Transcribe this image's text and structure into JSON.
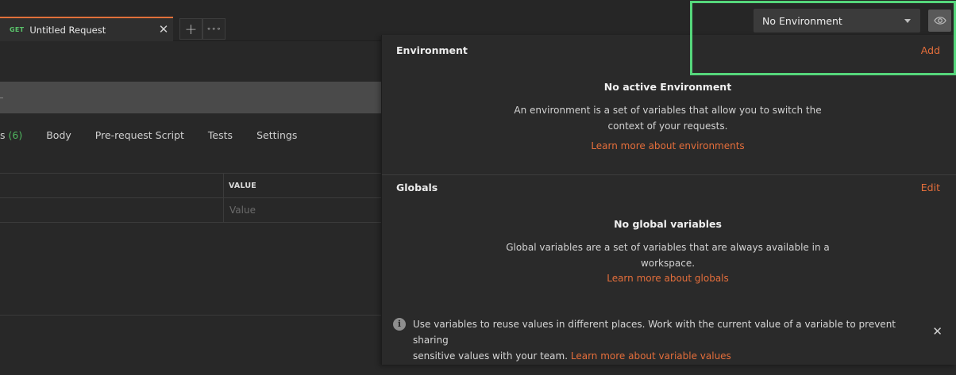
{
  "request_tab": {
    "method": "GET",
    "title": "Untitled Request",
    "close_glyph": "✕"
  },
  "tab_actions": {
    "new_tab_glyph": "+",
    "more_glyph": "∘∘∘"
  },
  "environment_selector": {
    "selected": "No Environment",
    "caret_icon": "chevron-down-icon",
    "quick_look_icon": "eye-icon"
  },
  "request_editor": {
    "tabs": [
      {
        "label": "s",
        "count": "(6)"
      },
      {
        "label": "Body"
      },
      {
        "label": "Pre-request Script"
      },
      {
        "label": "Tests"
      },
      {
        "label": "Settings"
      }
    ],
    "table": {
      "value_header": "VALUE",
      "value_placeholder": "Value"
    }
  },
  "popover": {
    "environment": {
      "title": "Environment",
      "action": "Add",
      "empty_title": "No active Environment",
      "empty_desc_line1": "An environment is a set of variables that allow you to switch the",
      "empty_desc_line2": "context of your requests.",
      "link": "Learn more about environments"
    },
    "globals": {
      "title": "Globals",
      "action": "Edit",
      "empty_title": "No global variables",
      "empty_desc_line1": "Global variables are a set of variables that are always available in a",
      "empty_desc_line2": "workspace.",
      "link": "Learn more about globals"
    },
    "info": {
      "icon": "info-icon",
      "text_line1": "Use variables to reuse values in different places. Work with the current value of a variable to prevent sharing",
      "text_line2": "sensitive values with your team.",
      "link": "Learn more about variable values",
      "close_glyph": "✕"
    }
  },
  "colors": {
    "accent": "#e46e3b",
    "get_method": "#59c36a",
    "highlight": "#55d67b",
    "background": "#282828"
  }
}
